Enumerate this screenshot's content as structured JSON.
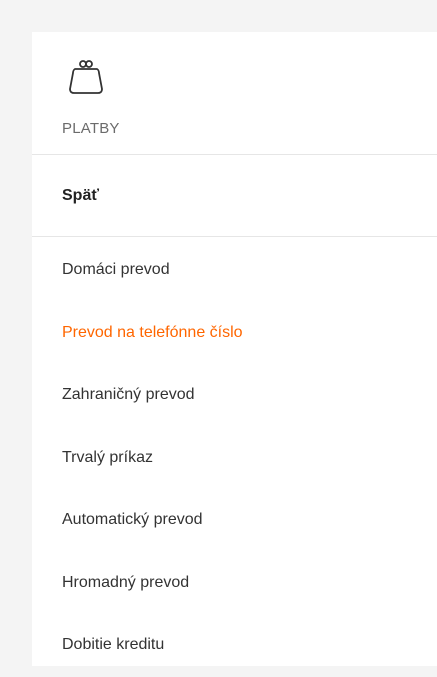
{
  "section": {
    "icon": "purse-icon",
    "title": "PLATBY"
  },
  "back": {
    "label": "Späť"
  },
  "menu": {
    "active_color": "#ff6600",
    "items": [
      {
        "label": "Domáci prevod",
        "active": false
      },
      {
        "label": "Prevod na telefónne číslo",
        "active": true
      },
      {
        "label": "Zahraničný prevod",
        "active": false
      },
      {
        "label": "Trvalý príkaz",
        "active": false
      },
      {
        "label": "Automatický prevod",
        "active": false
      },
      {
        "label": "Hromadný prevod",
        "active": false
      },
      {
        "label": "Dobitie kreditu",
        "active": false
      }
    ]
  }
}
